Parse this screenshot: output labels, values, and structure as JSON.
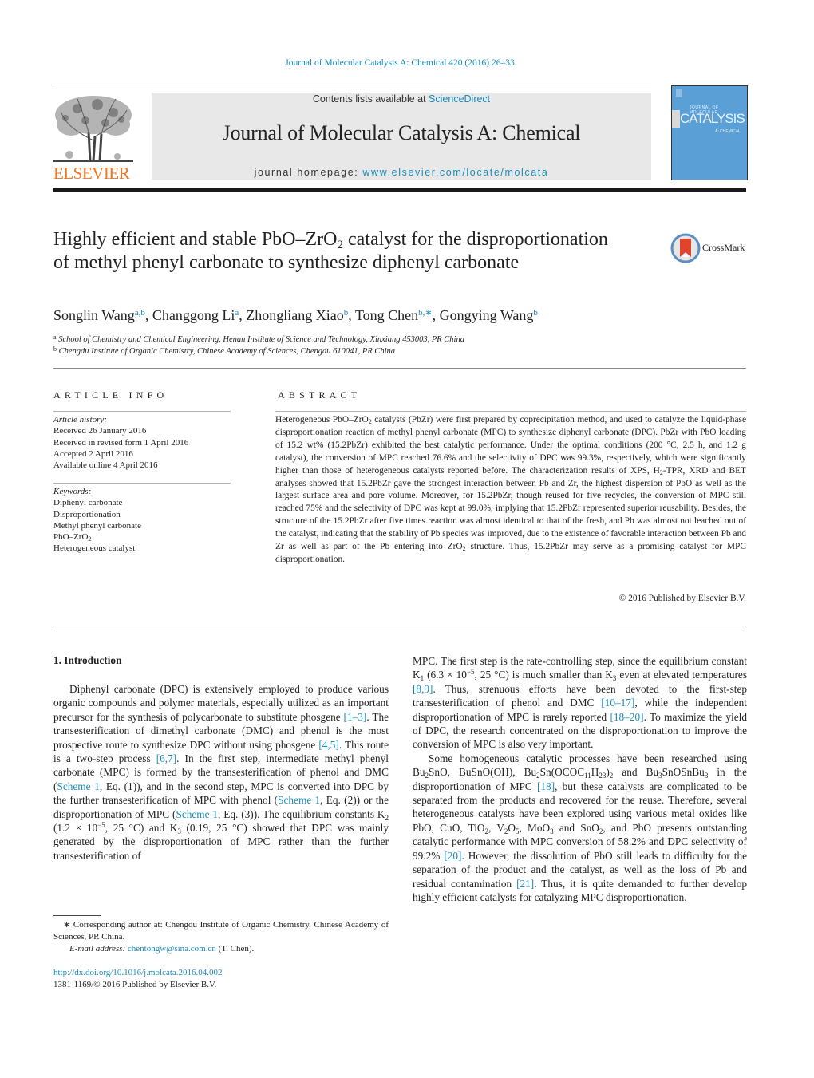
{
  "header": {
    "journal_reference": "Journal of Molecular Catalysis A: Chemical 420 (2016) 26–33",
    "contents_prefix": "Contents lists available at ",
    "contents_link": "ScienceDirect",
    "journal_title": "Journal of Molecular Catalysis A: Chemical",
    "homepage_prefix": "journal homepage: ",
    "homepage_link": "www.elsevier.com/locate/molcata",
    "publisher_logo_text": "ELSEVIER",
    "cover_title": "CATALYSIS",
    "cover_subtitle": "JOURNAL OF MOLECULAR",
    "cover_chem": "A: CHEMICAL",
    "crossmark_label": "CrossMark",
    "colors": {
      "link": "#1a8cbc",
      "elsevier_orange": "#f37321",
      "cover_blue": "#5a9fd6",
      "band_gray": "#e8e8e8"
    }
  },
  "article": {
    "title_part1": "Highly efficient and stable PbO–ZrO",
    "title_sub": "2",
    "title_part2": " catalyst for the disproportionation of methyl phenyl carbonate to synthesize diphenyl carbonate",
    "authors": [
      {
        "name": "Songlin Wang",
        "sup": "a,b"
      },
      {
        "name": "Changgong Li",
        "sup": "a"
      },
      {
        "name": "Zhongliang Xiao",
        "sup": "b"
      },
      {
        "name": "Tong Chen",
        "sup": "b,∗"
      },
      {
        "name": "Gongying Wang",
        "sup": "b"
      }
    ],
    "affiliations": [
      {
        "mark": "a",
        "text": "School of Chemistry and Chemical Engineering, Henan Institute of Science and Technology, Xinxiang 453003, PR China"
      },
      {
        "mark": "b",
        "text": "Chengdu Institute of Organic Chemistry, Chinese Academy of Sciences, Chengdu 610041, PR China"
      }
    ]
  },
  "article_info": {
    "heading": "ARTICLE INFO",
    "history_label": "Article history:",
    "history": [
      "Received 26 January 2016",
      "Received in revised form 1 April 2016",
      "Accepted 2 April 2016",
      "Available online 4 April 2016"
    ],
    "keywords_label": "Keywords:",
    "keywords": [
      "Diphenyl carbonate",
      "Disproportionation",
      "Methyl phenyl carbonate",
      "PbO–ZrO2",
      "Heterogeneous catalyst"
    ]
  },
  "abstract": {
    "heading": "ABSTRACT",
    "s1": "Heterogeneous PbO–ZrO",
    "s2": " catalysts (PbZr) were first prepared by coprecipitation method, and used to catalyze the liquid-phase disproportionation reaction of methyl phenyl carbonate (MPC) to synthesize diphenyl carbonate (DPC). PbZr with PbO loading of 15.2 wt% (15.2PbZr) exhibited the best catalytic performance. Under the optimal conditions (200 °C, 2.5 h, and 1.2 g catalyst), the conversion of MPC reached 76.6% and the selectivity of DPC was 99.3%, respectively, which were significantly higher than those of heterogeneous catalysts reported before. The characterization results of XPS, H",
    "s3": "-TPR, XRD and BET analyses showed that 15.2PbZr gave the strongest interaction between Pb and Zr, the highest dispersion of PbO as well as the largest surface area and pore volume. Moreover, for 15.2PbZr, though reused for five recycles, the conversion of MPC still reached 75% and the selectivity of DPC was kept at 99.0%, implying that 15.2PbZr represented superior reusability. Besides, the structure of the 15.2PbZr after five times reaction was almost identical to that of the fresh, and Pb was almost not leached out of the catalyst, indicating that the stability of Pb species was improved, due to the existence of favorable interaction between Pb and Zr as well as part of the Pb entering into ZrO",
    "s4": " structure. Thus, 15.2PbZr may serve as a promising catalyst for MPC disproportionation.",
    "sub2": "2",
    "copyright": "© 2016 Published by Elsevier B.V."
  },
  "introduction": {
    "heading": "1.  Introduction",
    "p1": [
      "Diphenyl carbonate (DPC) is extensively employed to produce various organic compounds and polymer materials, especially utilized as an important precursor for the synthesis of polycarbonate to substitute phosgene ",
      "[1–3]",
      ". The transesterification of dimethyl carbonate (DMC) and phenol is the most prospective route to synthesize DPC without using phosgene ",
      "[4,5]",
      ". This route is a two-step process ",
      "[6,7]",
      ". In the first step, intermediate methyl phenyl carbonate (MPC) is formed by the transesterification of phenol and DMC (",
      "Scheme 1",
      ", Eq. (1)), and in the second step, MPC is converted into DPC by the further transesterification of MPC with phenol (",
      "Scheme 1",
      ", Eq. (2)) or the disproportionation of MPC (",
      "Scheme 1",
      ", Eq. (3)). The equilibrium constants K",
      "2",
      " (1.2 × 10",
      "−5",
      ", 25 °C) and K",
      "3",
      " (0.19, 25 °C) showed that DPC was mainly generated by the disproportionation of MPC rather than the further transesterification of"
    ],
    "p1_cont": [
      "MPC. The first step is the rate-controlling step, since the equilibrium constant K",
      "1",
      " (6.3 × 10",
      "−5",
      ", 25 °C) is much smaller than K",
      "3",
      " even at elevated temperatures ",
      "[8,9]",
      ". Thus, strenuous efforts have been devoted to the first-step transesterification of phenol and DMC ",
      "[10–17]",
      ", while the independent disproportionation of MPC is rarely reported ",
      "[18–20]",
      ". To maximize the yield of DPC, the research concentrated on the disproportionation to improve the conversion of MPC is also very important."
    ],
    "p2": [
      "Some homogeneous catalytic processes have been researched using Bu",
      "2",
      "SnO, BuSnO(OH), Bu",
      "2",
      "Sn(OCOC",
      "11",
      "H",
      "23",
      ")",
      "2",
      " and Bu",
      "3",
      "SnOSnBu",
      "3",
      " in the disproportionation of MPC ",
      "[18]",
      ", but these catalysts are complicated to be separated from the products and recovered for the reuse. Therefore, several heterogeneous catalysts have been explored using various metal oxides like PbO, CuO, TiO",
      "2",
      ", V",
      "2",
      "O",
      "5",
      ", MoO",
      "3",
      " and SnO",
      "2",
      ", and PbO presents outstanding catalytic performance with MPC conversion of 58.2% and DPC selectivity of 99.2% ",
      "[20]",
      ". However, the dissolution of PbO still leads to difficulty for the separation of the product and the catalyst, as well as the loss of Pb and residual contamination ",
      "[21]",
      ". Thus, it is quite demanded to further develop highly efficient catalysts for catalyzing MPC disproportionation."
    ]
  },
  "footnote": {
    "corresponding": "∗  Corresponding author at: Chengdu Institute of Organic Chemistry, Chinese Academy of Sciences, PR China.",
    "email_label": "E-mail address: ",
    "email": "chentongw@sina.com.cn",
    "email_suffix": " (T. Chen).",
    "doi": "http://dx.doi.org/10.1016/j.molcata.2016.04.002",
    "issn": "1381-1169/© 2016 Published by Elsevier B.V."
  }
}
